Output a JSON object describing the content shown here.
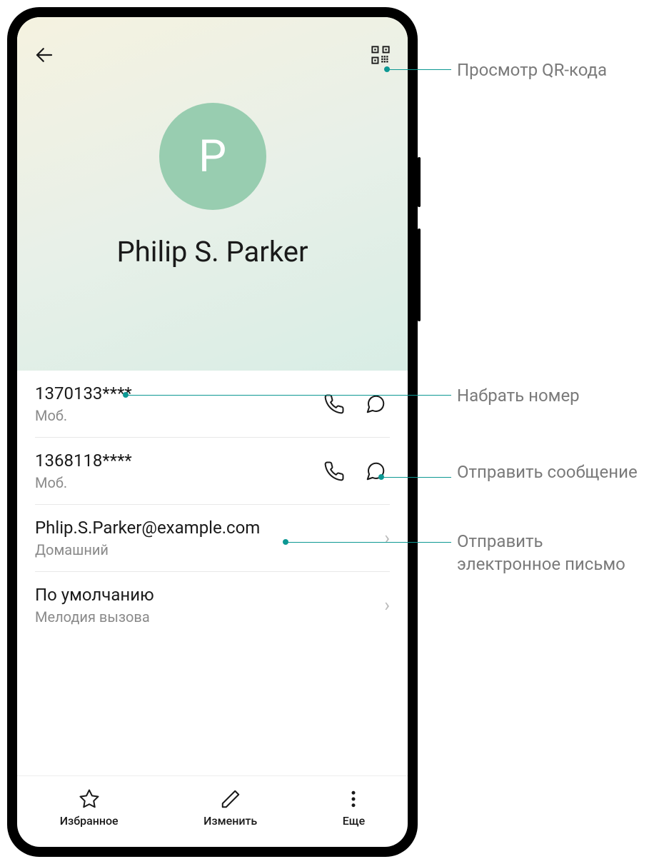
{
  "contact": {
    "avatar_letter": "P",
    "name": "Philip S. Parker"
  },
  "phones": [
    {
      "number": "1370133****",
      "type": "Моб."
    },
    {
      "number": "1368118****",
      "type": "Моб."
    }
  ],
  "email": {
    "address": "Phlip.S.Parker@example.com",
    "type": "Домашний"
  },
  "ringtone": {
    "value": "По умолчанию",
    "label": "Мелодия вызова"
  },
  "bottombar": {
    "favorite": "Избранное",
    "edit": "Изменить",
    "more": "Еще"
  },
  "annotations": {
    "qr": "Просмотр QR-кода",
    "dial": "Набрать номер",
    "sms": "Отправить сообщение",
    "mail": "Отправить электронное письмо"
  }
}
